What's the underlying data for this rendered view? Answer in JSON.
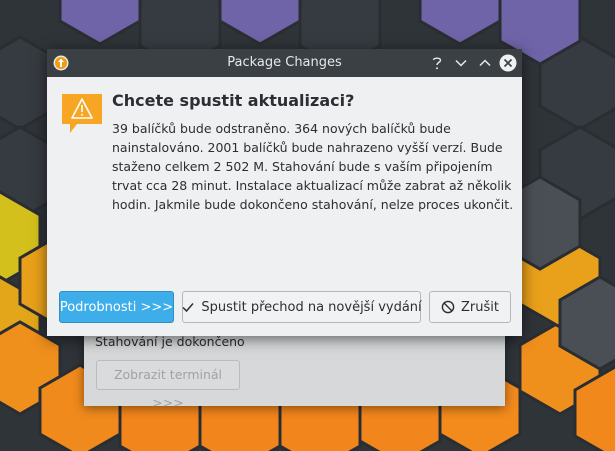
{
  "window": {
    "title": "Package Changes"
  },
  "dialog": {
    "heading": "Chcete spustit aktualizaci?",
    "message": "39 balíčků bude odstraněno. 364 nových balíčků bude nainstalováno. 2001 balíčků bude nahrazeno vyšší verzí. Bude staženo celkem 2 502 M. Stahování bude s vaším připojením trvat cca 28 minut. Instalace aktualizací může zabrat až několik hodin. Jakmile bude dokončeno stahování, nelze proces ukončit."
  },
  "buttons": {
    "details": "Podrobnosti >>>",
    "upgrade": "Spustit přechod na novější vydání",
    "cancel": "Zrušit"
  },
  "background_window": {
    "status": "Stahování je dokončeno",
    "terminal_button": "Zobrazit terminál >>>"
  },
  "icons": {
    "app": "upgrade-icon",
    "warning": "warning-icon",
    "help": "help-icon",
    "minimize": "minimize-icon",
    "maximize": "maximize-icon",
    "close": "close-icon",
    "check": "check-icon",
    "cancel": "cancel-icon"
  },
  "colors": {
    "accent": "#3daee9",
    "titlebar": "#3b4045",
    "dialog_bg": "#eff0f1",
    "warning": "#f6a623"
  }
}
